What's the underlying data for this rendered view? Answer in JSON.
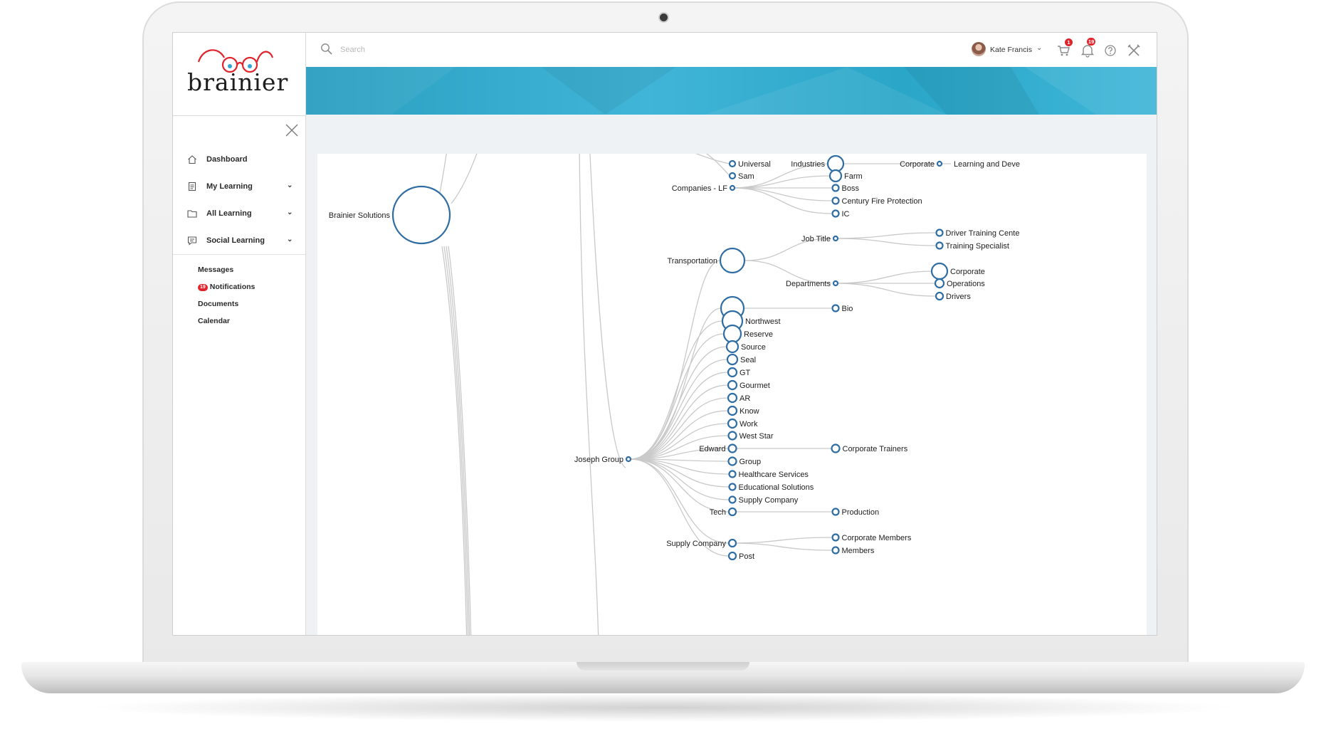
{
  "brand": {
    "logo_text": "brainier",
    "accent": "#e0242b",
    "lens_color": "#2fa7d4"
  },
  "search": {
    "placeholder": "Search",
    "value": ""
  },
  "user": {
    "name": "Kate Francis"
  },
  "topbar": {
    "cart_badge": "1",
    "notifications_badge": "19",
    "icons": [
      "cart-icon",
      "bell-icon",
      "help-icon",
      "tools-icon"
    ]
  },
  "banner_color": "#36aed0",
  "sidebar": {
    "nav": [
      {
        "label": "Dashboard",
        "icon": "home-icon",
        "has_chevron": false
      },
      {
        "label": "My Learning",
        "icon": "document-icon",
        "has_chevron": true
      },
      {
        "label": "All Learning",
        "icon": "folder-icon",
        "has_chevron": true
      },
      {
        "label": "Social Learning",
        "icon": "chat-icon",
        "has_chevron": true
      }
    ],
    "sub": [
      {
        "label": "Messages"
      },
      {
        "label": "Notifications",
        "badge": "19"
      },
      {
        "label": "Documents"
      },
      {
        "label": "Calendar"
      }
    ]
  },
  "tree": {
    "node_color": "#2f6da3",
    "link_color": "#c9c9c9",
    "nodes": {
      "brainier": "Brainier Solutions",
      "universal": "Universal",
      "sam": "Sam",
      "companies_lf": "Companies - LF",
      "industries": "Industries",
      "corporate_top": "Corporate",
      "learning_dev": "Learning and Deve",
      "farm": "Farm",
      "boss": "Boss",
      "century": "Century Fire Protection",
      "ic": "IC",
      "transportation": "Transportation",
      "job_title": "Job Title",
      "driver_training": "Driver Training Cente",
      "training_specialist": "Training Specialist",
      "departments": "Departments",
      "corporate_dept": "Corporate",
      "operations": "Operations",
      "drivers": "Drivers",
      "bio": "Bio",
      "northwest": "Northwest",
      "reserve": "Reserve",
      "source": "Source",
      "seal": "Seal",
      "gt": "GT",
      "gourmet": "Gourmet",
      "ar": "AR",
      "know": "Know",
      "work": "Work",
      "west_star": "West Star",
      "edward": "Edward",
      "corporate_trainers": "Corporate Trainers",
      "group": "Group",
      "healthcare": "Healthcare Services",
      "educational": "Educational Solutions",
      "supply_company_leaf": "Supply Company",
      "tech": "Tech",
      "production": "Production",
      "supply_company": "Supply Company",
      "corporate_members": "Corporate Members",
      "members": "Members",
      "post": "Post",
      "joseph": "Joseph Group"
    }
  }
}
